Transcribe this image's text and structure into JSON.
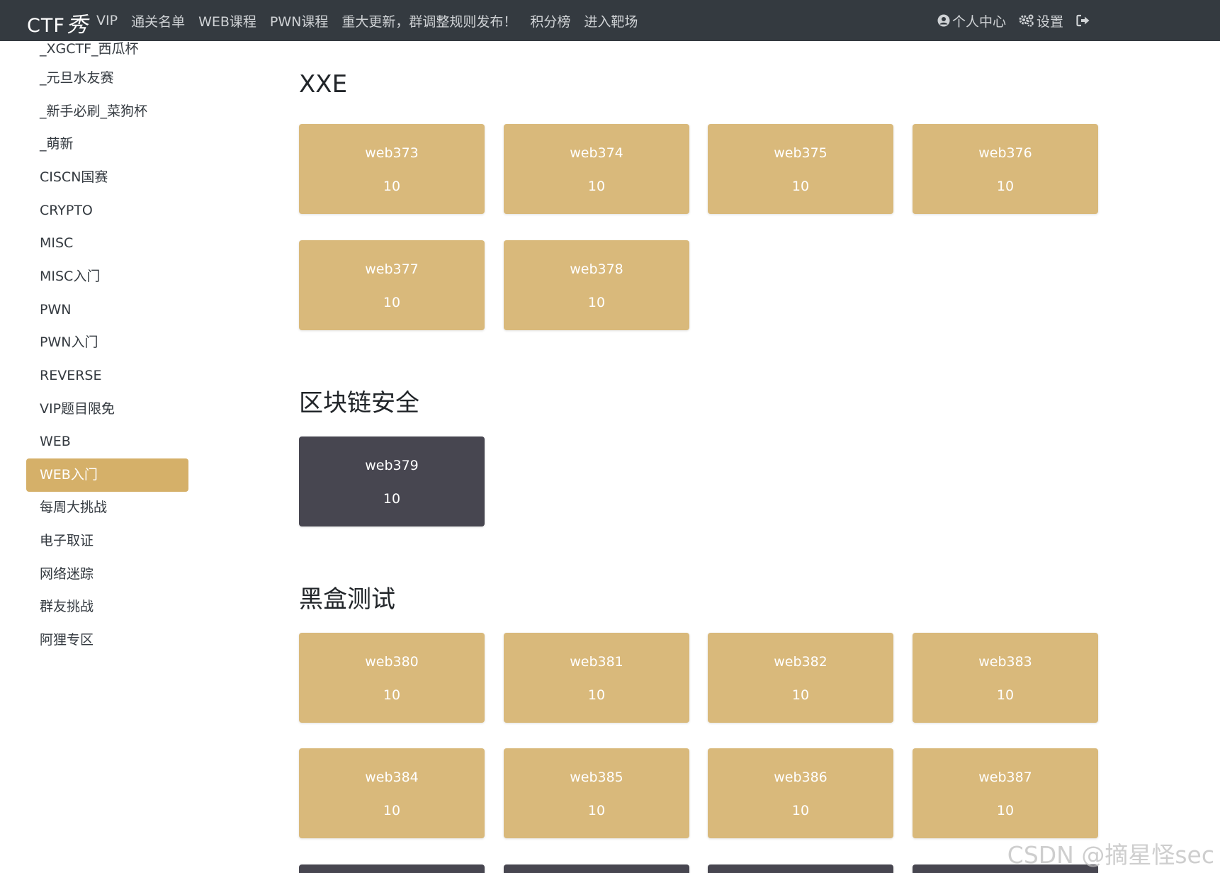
{
  "nav": {
    "brand": "CTF",
    "brand_mark": "秀",
    "links": [
      "VIP",
      "通关名单",
      "WEB课程",
      "PWN课程",
      "重大更新，群调整规则发布！",
      "积分榜",
      "进入靶场"
    ],
    "user_center": "个人中心",
    "settings": "设置",
    "icons": {
      "user": "user-circle-icon",
      "settings": "cogs-icon",
      "logout": "sign-out-icon"
    }
  },
  "sidebar": {
    "items": [
      "_XGCTF_西瓜杯",
      "_元旦水友赛",
      "_新手必刷_菜狗杯",
      "_萌新",
      "CISCN国赛",
      "CRYPTO",
      "MISC",
      "MISC入门",
      "PWN",
      "PWN入门",
      "REVERSE",
      "VIP题目限免",
      "WEB",
      "WEB入门",
      "每周大挑战",
      "电子取证",
      "网络迷踪",
      "群友挑战",
      "阿狸专区"
    ],
    "active": "WEB入门"
  },
  "sections": [
    {
      "title": "XXE",
      "challenges": [
        {
          "name": "web373",
          "score": "10"
        },
        {
          "name": "web374",
          "score": "10"
        },
        {
          "name": "web375",
          "score": "10"
        },
        {
          "name": "web376",
          "score": "10"
        },
        {
          "name": "web377",
          "score": "10"
        },
        {
          "name": "web378",
          "score": "10"
        }
      ]
    },
    {
      "title": "区块链安全",
      "challenges": [
        {
          "name": "web379",
          "score": "10",
          "solved": true
        }
      ]
    },
    {
      "title": "黑盒测试",
      "challenges": [
        {
          "name": "web380",
          "score": "10"
        },
        {
          "name": "web381",
          "score": "10"
        },
        {
          "name": "web382",
          "score": "10"
        },
        {
          "name": "web383",
          "score": "10"
        },
        {
          "name": "web384",
          "score": "10"
        },
        {
          "name": "web385",
          "score": "10"
        },
        {
          "name": "web386",
          "score": "10"
        },
        {
          "name": "web387",
          "score": "10"
        }
      ]
    }
  ],
  "colors": {
    "navbar": "#343a40",
    "accent": "#d5b069",
    "card": "#d9b97b",
    "card_solved": "#474650"
  },
  "watermark": "CSDN @摘星怪sec"
}
